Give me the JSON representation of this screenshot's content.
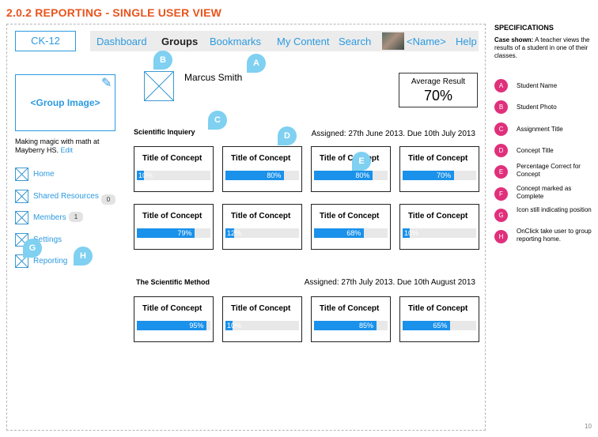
{
  "page_title": "2.0.2  REPORTING - SINGLE USER VIEW",
  "page_number": "10",
  "header": {
    "logo": "CK-12",
    "nav": [
      "Dashboard",
      "Groups",
      "Bookmarks",
      "My Content",
      "Search"
    ],
    "active_nav": "Groups",
    "user_name": "<Name>",
    "help": "Help"
  },
  "sidebar": {
    "group_image": "<Group Image>",
    "group_description": "Making magic with math at Mayberry HS.",
    "edit_link": "Edit",
    "items": [
      {
        "label": "Home",
        "badge": ""
      },
      {
        "label": "Shared Resources",
        "badge": "0"
      },
      {
        "label": "Members",
        "badge": "1"
      },
      {
        "label": "Settings",
        "badge": ""
      },
      {
        "label": "Reporting",
        "badge": ""
      }
    ]
  },
  "student": {
    "name": "Marcus Smith",
    "average_label": "Average Result",
    "average_value": "70%"
  },
  "sections": [
    {
      "title": "Scientific Inquiery",
      "assigned": "Assigned: 27th June 2013. Due 10th July 2013",
      "concepts": [
        {
          "title": "Title of Concept",
          "percent": 10,
          "label": "10%"
        },
        {
          "title": "Title of Concept",
          "percent": 80,
          "label": "80%"
        },
        {
          "title": "Title of Concept",
          "percent": 80,
          "label": "80%"
        },
        {
          "title": "Title of Concept",
          "percent": 70,
          "label": "70%"
        },
        {
          "title": "Title of Concept",
          "percent": 79,
          "label": "79%"
        },
        {
          "title": "Title of Concept",
          "percent": 12,
          "label": "12%"
        },
        {
          "title": "Title of Concept",
          "percent": 68,
          "label": "68%"
        },
        {
          "title": "Title of Concept",
          "percent": 10,
          "label": "10%"
        }
      ]
    },
    {
      "title": "The Scientific Method",
      "assigned": "Assigned: 27th July 2013. Due 10th August 2013",
      "concepts": [
        {
          "title": "Title of Concept",
          "percent": 95,
          "label": "95%"
        },
        {
          "title": "Title of Concept",
          "percent": 10,
          "label": "10%"
        },
        {
          "title": "Title of Concept",
          "percent": 85,
          "label": "85%"
        },
        {
          "title": "Title of Concept",
          "percent": 65,
          "label": "65%"
        }
      ]
    }
  ],
  "callouts": [
    "A",
    "B",
    "C",
    "D",
    "E",
    "G",
    "H"
  ],
  "specifications": {
    "title": "SPECIFICATIONS",
    "case_label": "Case shown:",
    "case_text": "A teacher views the results of a student in one of their classes.",
    "items": [
      {
        "letter": "A",
        "text": "Student Name"
      },
      {
        "letter": "B",
        "text": "Student Photo"
      },
      {
        "letter": "C",
        "text": "Assignment Title"
      },
      {
        "letter": "D",
        "text": "Concept Title"
      },
      {
        "letter": "E",
        "text": "Percentage Correct for Concept"
      },
      {
        "letter": "F",
        "text": "Concept marked as Complete"
      },
      {
        "letter": "G",
        "text": "Icon still indicating position"
      },
      {
        "letter": "H",
        "text": "OnClick take user to group reporting home."
      }
    ]
  },
  "colors": {
    "title": "#e8541c",
    "link": "#2c9ae0",
    "progress": "#1a91ea",
    "callout": "#7fd0f1",
    "spec_dot": "#e0307c"
  }
}
